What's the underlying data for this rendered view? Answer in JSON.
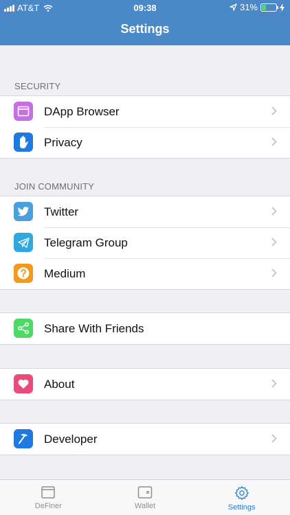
{
  "status": {
    "carrier": "AT&T",
    "time": "09:38",
    "battery_pct": "31%",
    "battery_level": 0.31
  },
  "header": {
    "title": "Settings"
  },
  "sections": {
    "security": {
      "label": "SECURITY",
      "items": [
        {
          "label": "DApp Browser"
        },
        {
          "label": "Privacy"
        }
      ]
    },
    "community": {
      "label": "JOIN COMMUNITY",
      "items": [
        {
          "label": "Twitter"
        },
        {
          "label": "Telegram Group"
        },
        {
          "label": "Medium"
        }
      ]
    },
    "share": {
      "items": [
        {
          "label": "Share With Friends"
        }
      ]
    },
    "about": {
      "items": [
        {
          "label": "About"
        }
      ]
    },
    "developer": {
      "items": [
        {
          "label": "Developer"
        }
      ]
    }
  },
  "icons": {
    "dapp": {
      "name": "browser-window-icon",
      "color": "#c76fe2"
    },
    "privacy": {
      "name": "hand-icon",
      "color": "#1f7ae0"
    },
    "twitter": {
      "name": "twitter-bird-icon",
      "color": "#4a9fdc"
    },
    "telegram": {
      "name": "paper-plane-icon",
      "color": "#2ea8dd"
    },
    "medium": {
      "name": "question-icon",
      "color": "#f39a1e"
    },
    "share": {
      "name": "share-icon",
      "color": "#4cd964"
    },
    "about": {
      "name": "heart-icon",
      "color": "#e94b7a"
    },
    "developer": {
      "name": "hammer-icon",
      "color": "#1f7ae0"
    }
  },
  "tabbar": {
    "tabs": [
      {
        "label": "DeFiner"
      },
      {
        "label": "Wallet"
      },
      {
        "label": "Settings",
        "active": true
      }
    ]
  },
  "colors": {
    "header": "#4b88c8",
    "accent": "#1c7ed6"
  }
}
